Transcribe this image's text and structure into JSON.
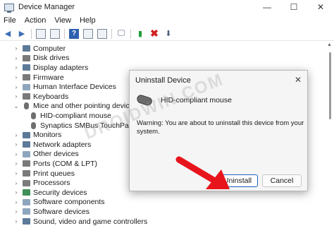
{
  "window": {
    "title": "Device Manager",
    "minimize_glyph": "—",
    "maximize_glyph": "☐",
    "close_glyph": "✕"
  },
  "menu": [
    "File",
    "Action",
    "View",
    "Help"
  ],
  "toolbar": {
    "icons": [
      "back-arrow-icon",
      "forward-arrow-icon",
      "properties-grid-icon",
      "view-grid-icon",
      "help-icon",
      "show-hidden-icon",
      "grid-icon",
      "monitor-icon",
      "add-driver-icon",
      "uninstall-icon",
      "update-driver-icon"
    ]
  },
  "tree": {
    "items": [
      {
        "label": "Computer",
        "arrow": "›",
        "level": 0
      },
      {
        "label": "Disk drives",
        "arrow": "›",
        "level": 0
      },
      {
        "label": "Display adapters",
        "arrow": "›",
        "level": 0
      },
      {
        "label": "Firmware",
        "arrow": "›",
        "level": 0
      },
      {
        "label": "Human Interface Devices",
        "arrow": "›",
        "level": 0
      },
      {
        "label": "Keyboards",
        "arrow": "›",
        "level": 0
      },
      {
        "label": "Mice and other pointing devices",
        "arrow": "⌄",
        "level": 0
      },
      {
        "label": "HID-compliant mouse",
        "arrow": "",
        "level": 1
      },
      {
        "label": "Synaptics SMBus TouchPad",
        "arrow": "",
        "level": 1
      },
      {
        "label": "Monitors",
        "arrow": "›",
        "level": 0
      },
      {
        "label": "Network adapters",
        "arrow": "›",
        "level": 0
      },
      {
        "label": "Other devices",
        "arrow": "›",
        "level": 0
      },
      {
        "label": "Ports (COM & LPT)",
        "arrow": "›",
        "level": 0
      },
      {
        "label": "Print queues",
        "arrow": "›",
        "level": 0
      },
      {
        "label": "Processors",
        "arrow": "›",
        "level": 0
      },
      {
        "label": "Security devices",
        "arrow": "›",
        "level": 0
      },
      {
        "label": "Software components",
        "arrow": "›",
        "level": 0
      },
      {
        "label": "Software devices",
        "arrow": "›",
        "level": 0
      },
      {
        "label": "Sound, video and game controllers",
        "arrow": "›",
        "level": 0
      }
    ]
  },
  "dialog": {
    "title": "Uninstall Device",
    "close_glyph": "✕",
    "device_name": "HID-compliant mouse",
    "warning": "Warning: You are about to uninstall this device from your system.",
    "uninstall_label": "Uninstall",
    "cancel_label": "Cancel"
  },
  "watermark": "DROIDWIN.COM",
  "colors": {
    "accent_blue": "#1f5fbf",
    "annotation_red": "#e8141c",
    "dialog_bg": "#f5f5f5"
  }
}
